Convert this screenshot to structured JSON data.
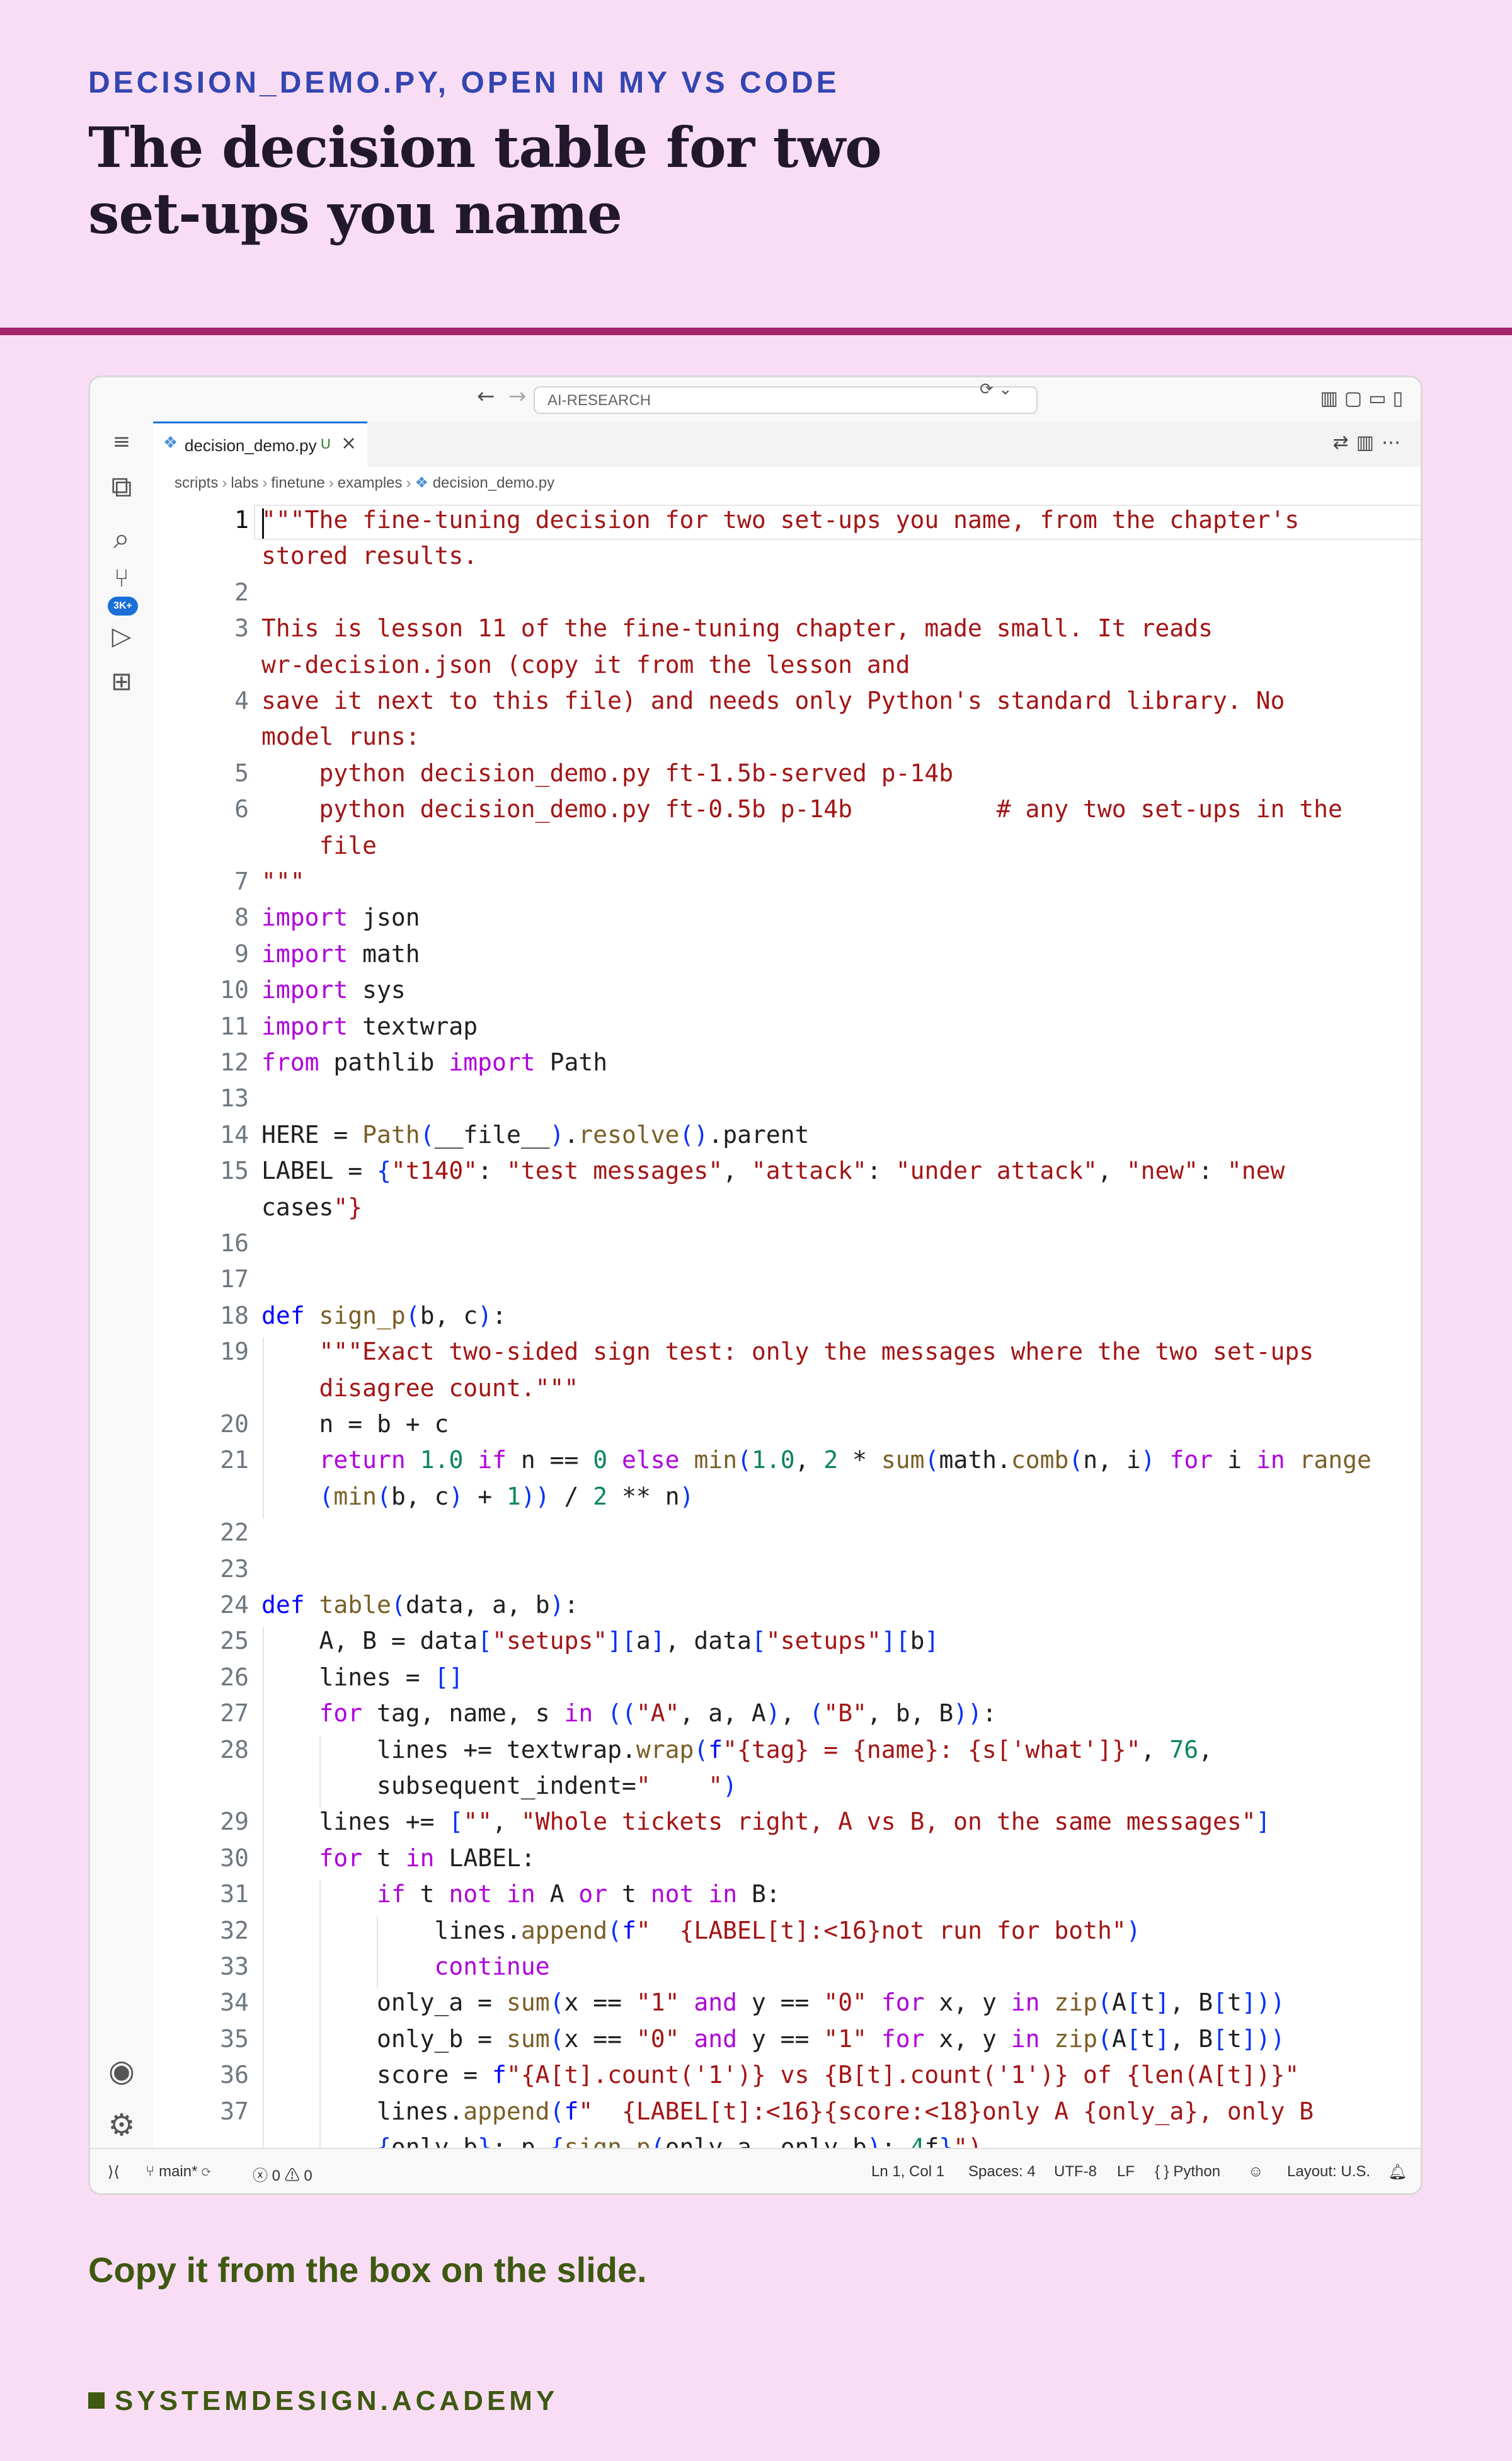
{
  "slide": {
    "kicker": "DECISION_DEMO.PY, OPEN IN MY VS CODE",
    "title": "The decision table for two set-ups you name",
    "footer": "Copy it from the box on the slide.",
    "brand": "SYSTEMDESIGN.ACADEMY"
  },
  "colors": {
    "background": "#f9ddf5",
    "accent_rule": "#a4246b",
    "kicker": "#3346b0",
    "brand": "#3d5a10"
  },
  "window": {
    "command_center": "AI-RESEARCH",
    "tab": {
      "label": "decision_demo.py",
      "status": "U",
      "icon": "python-file-icon"
    },
    "breadcrumb": [
      "scripts",
      "labs",
      "finetune",
      "examples",
      "decision_demo.py"
    ],
    "activity_badge": "3K+"
  },
  "editor": {
    "gutter": [
      "1",
      "",
      "2",
      "3",
      "",
      "4",
      "",
      "5",
      "6",
      "",
      "7",
      "8",
      "9",
      "10",
      "11",
      "12",
      "13",
      "14",
      "15",
      "",
      "16",
      "17",
      "18",
      "19",
      "",
      "20",
      "21",
      "",
      "22",
      "23",
      "24",
      "25",
      "26",
      "27",
      "28",
      "",
      "29",
      "30",
      "31",
      "32",
      "33",
      "34",
      "35",
      "36",
      "37",
      ""
    ],
    "lines": [
      "\"\"\"The fine-tuning decision for two set-ups you name, from the chapter's",
      "stored results.",
      "",
      "This is lesson 11 of the fine-tuning chapter, made small. It reads",
      "wr-decision.json (copy it from the lesson and",
      "save it next to this file) and needs only Python's standard library. No",
      "model runs:",
      "    python decision_demo.py ft-1.5b-served p-14b",
      "    python decision_demo.py ft-0.5b p-14b          # any two set-ups in the",
      "    file",
      "\"\"\"",
      "import json",
      "import math",
      "import sys",
      "import textwrap",
      "from pathlib import Path",
      "",
      "HERE = Path(__file__).resolve().parent",
      "LABEL = {\"t140\": \"test messages\", \"attack\": \"under attack\", \"new\": \"new",
      "cases\"}",
      "",
      "",
      "def sign_p(b, c):",
      "    \"\"\"Exact two-sided sign test: only the messages where the two set-ups",
      "    disagree count.\"\"\"",
      "    n = b + c",
      "    return 1.0 if n == 0 else min(1.0, 2 * sum(math.comb(n, i) for i in range",
      "    (min(b, c) + 1)) / 2 ** n)",
      "",
      "",
      "def table(data, a, b):",
      "    A, B = data[\"setups\"][a], data[\"setups\"][b]",
      "    lines = []",
      "    for tag, name, s in ((\"A\", a, A), (\"B\", b, B)):",
      "        lines += textwrap.wrap(f\"{tag} = {name}: {s['what']}\", 76,",
      "        subsequent_indent=\"    \")",
      "    lines += [\"\", \"Whole tickets right, A vs B, on the same messages\"]",
      "    for t in LABEL:",
      "        if t not in A or t not in B:",
      "            lines.append(f\"  {LABEL[t]:<16}not run for both\")",
      "            continue",
      "        only_a = sum(x == \"1\" and y == \"0\" for x, y in zip(A[t], B[t]))",
      "        only_b = sum(x == \"0\" and y == \"1\" for x, y in zip(A[t], B[t]))",
      "        score = f\"{A[t].count('1')} vs {B[t].count('1')} of {len(A[t])}\"",
      "        lines.append(f\"  {LABEL[t]:<16}{score:<18}only A {only_a}, only B",
      "        {only_b}; p {sign_p(only_a, only_b):.4f}\")"
    ]
  },
  "status": {
    "branch": "main*",
    "errors": "0",
    "warnings": "0",
    "position": "Ln 1, Col 1",
    "spaces": "Spaces: 4",
    "encoding": "UTF-8",
    "eol": "LF",
    "language": "Python",
    "layout": "Layout: U.S."
  }
}
